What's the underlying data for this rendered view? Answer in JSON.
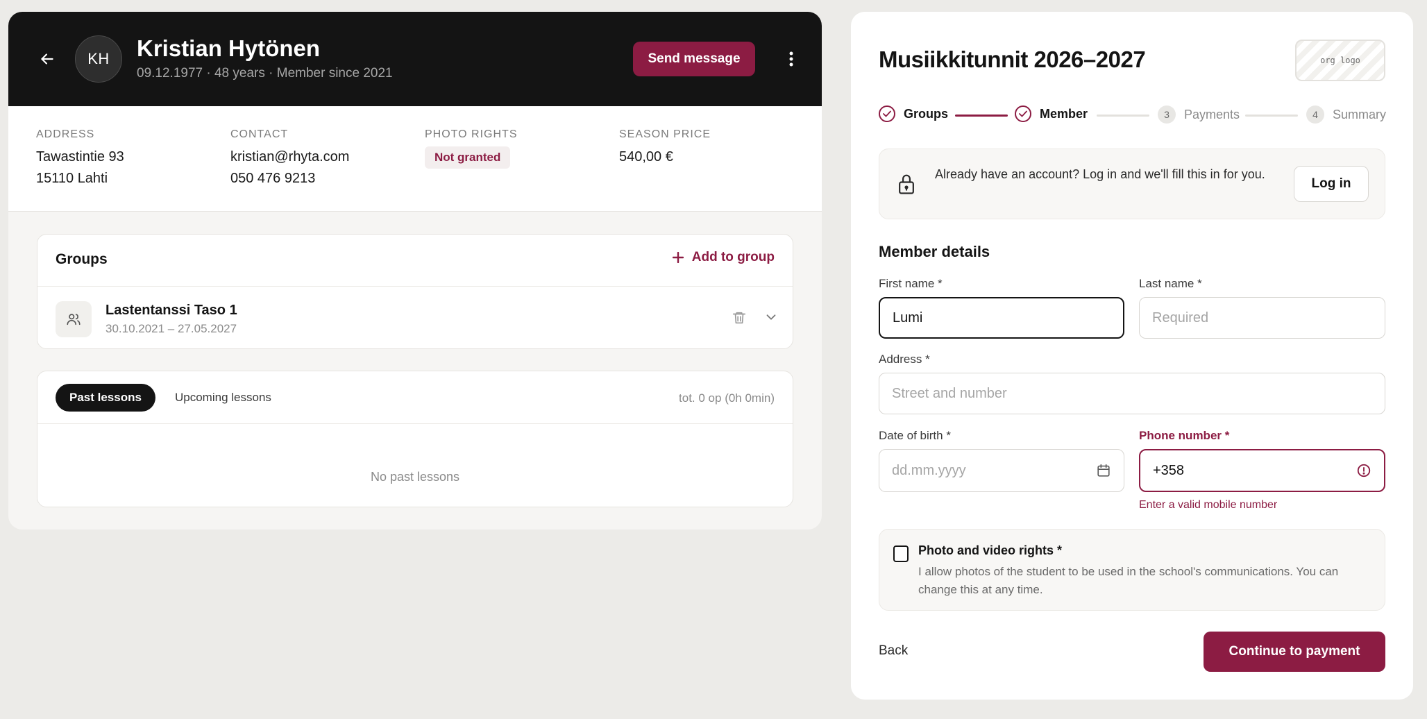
{
  "member": {
    "initials": "KH",
    "name": "Kristian Hytönen",
    "meta": "09.12.1977 · 48 years · Member since 2021",
    "send_message_label": "Send message"
  },
  "info": {
    "address_label": "ADDRESS",
    "address_line1": "Tawastintie 93",
    "address_line2": "15110 Lahti",
    "contact_label": "CONTACT",
    "email": "kristian@rhyta.com",
    "phone": "050 476 9213",
    "photo_label": "PHOTO RIGHTS",
    "photo_status": "Not granted",
    "price_label": "SEASON PRICE",
    "price": "540,00 €"
  },
  "groups": {
    "title": "Groups",
    "add_label": "Add to group",
    "items": [
      {
        "name": "Lastentanssi Taso 1",
        "dates": "30.10.2021 – 27.05.2027"
      }
    ]
  },
  "lessons": {
    "tab_past": "Past lessons",
    "tab_upcoming": "Upcoming lessons",
    "total": "tot. 0 op (0h 0min)",
    "empty": "No past lessons"
  },
  "form": {
    "title": "Musiikkitunnit 2026–2027",
    "org_logo": "org logo",
    "steps": [
      {
        "num": "1",
        "label": "Groups",
        "state": "done"
      },
      {
        "num": "2",
        "label": "Member",
        "state": "done"
      },
      {
        "num": "3",
        "label": "Payments",
        "state": "todo"
      },
      {
        "num": "4",
        "label": "Summary",
        "state": "todo"
      }
    ],
    "login_text": "Already have an account? Log in and we'll fill this in for you.",
    "login_button": "Log in",
    "section_title": "Member details",
    "first_name": {
      "label": "First name *",
      "value": "Lumi"
    },
    "last_name": {
      "label": "Last name *",
      "placeholder": "Required"
    },
    "address": {
      "label": "Address *",
      "placeholder": "Street and number"
    },
    "dob": {
      "label": "Date of birth *",
      "placeholder": "dd.mm.yyyy"
    },
    "phone": {
      "label": "Phone number *",
      "value": "+358",
      "error": "Enter a valid mobile number"
    },
    "consent_title": "Photo and video rights *",
    "consent_text": "I allow photos of the student to be used in the school's communications. You can change this at any time.",
    "back_label": "Back",
    "continue_label": "Continue to payment"
  },
  "colors": {
    "accent": "#8c1c43",
    "header_bg": "#141414",
    "page_bg": "#ecebe8"
  }
}
